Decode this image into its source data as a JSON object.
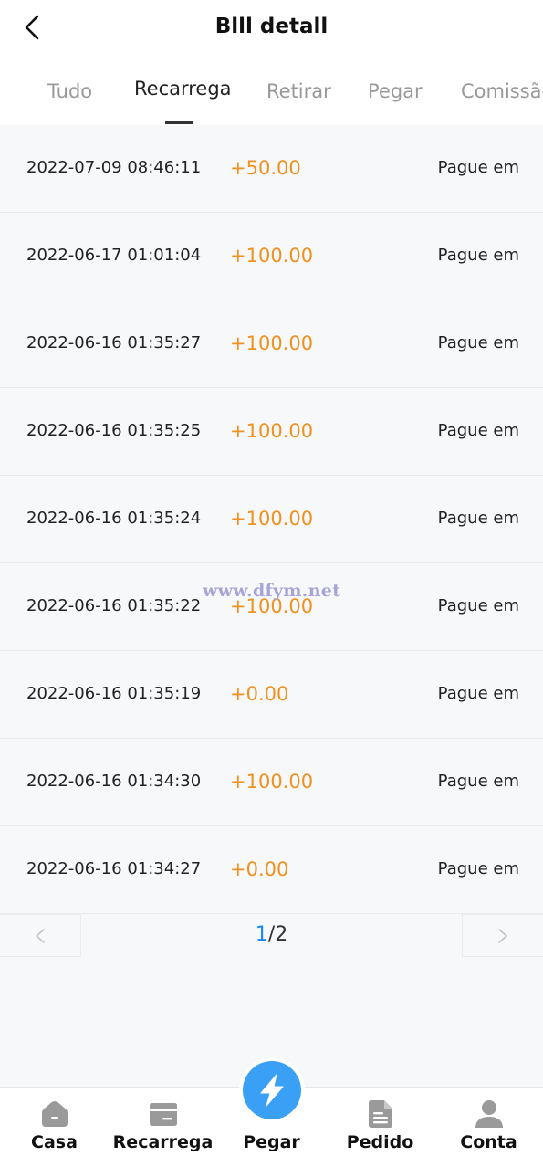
{
  "header": {
    "title": "Blll detall"
  },
  "tabs": [
    {
      "label": "Tudo"
    },
    {
      "label": "Recarrega"
    },
    {
      "label": "Retirar"
    },
    {
      "label": "Pegar"
    },
    {
      "label": "Comissão"
    }
  ],
  "active_tab": "Recarrega",
  "records": [
    {
      "date": "2022-07-09 08:46:11",
      "amount": "+50.00",
      "status": "Pague em"
    },
    {
      "date": "2022-06-17 01:01:04",
      "amount": "+100.00",
      "status": "Pague em"
    },
    {
      "date": "2022-06-16 01:35:27",
      "amount": "+100.00",
      "status": "Pague em"
    },
    {
      "date": "2022-06-16 01:35:25",
      "amount": "+100.00",
      "status": "Pague em"
    },
    {
      "date": "2022-06-16 01:35:24",
      "amount": "+100.00",
      "status": "Pague em"
    },
    {
      "date": "2022-06-16 01:35:22",
      "amount": "+100.00",
      "status": "Pague em"
    },
    {
      "date": "2022-06-16 01:35:19",
      "amount": "+0.00",
      "status": "Pague em"
    },
    {
      "date": "2022-06-16 01:34:30",
      "amount": "+100.00",
      "status": "Pague em"
    },
    {
      "date": "2022-06-16 01:34:27",
      "amount": "+0.00",
      "status": "Pague em"
    }
  ],
  "pagination": {
    "current": "1",
    "separator": "/",
    "total": "2",
    "prev_icon": "chevron-left-icon",
    "next_icon": "chevron-right-icon"
  },
  "watermark": "www.dfym.net",
  "bottom_nav": [
    {
      "label": "Casa",
      "icon": "home-icon"
    },
    {
      "label": "Recarrega",
      "icon": "card-icon"
    },
    {
      "label": "Pegar",
      "icon": "lightning-icon"
    },
    {
      "label": "Pedido",
      "icon": "document-icon"
    },
    {
      "label": "Conta",
      "icon": "user-icon"
    }
  ],
  "colors": {
    "accent_amount": "#f0901e",
    "primary": "#3aa0f5",
    "page_current": "#1989fa",
    "nav_icon": "#999999"
  }
}
